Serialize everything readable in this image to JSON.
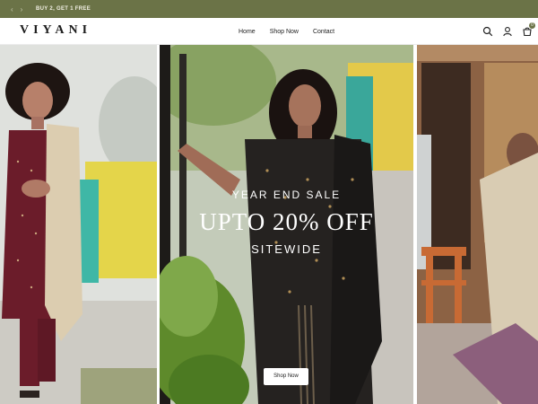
{
  "announcement": {
    "prev_arrow": "‹",
    "next_arrow": "›",
    "message": "BUY 2, GET 1 FREE",
    "bg_color": "#6b7347"
  },
  "header": {
    "logo": "VIYANI",
    "nav": [
      {
        "label": "Home"
      },
      {
        "label": "Shop Now"
      },
      {
        "label": "Contact"
      }
    ],
    "icons": [
      "search-icon",
      "account-icon",
      "cart-icon"
    ],
    "cart_count": "0"
  },
  "hero": {
    "line1": "YEAR END SALE",
    "line2": "UPTO 20% OFF",
    "line3": "SITEWIDE",
    "button_label": "Shop Now"
  }
}
